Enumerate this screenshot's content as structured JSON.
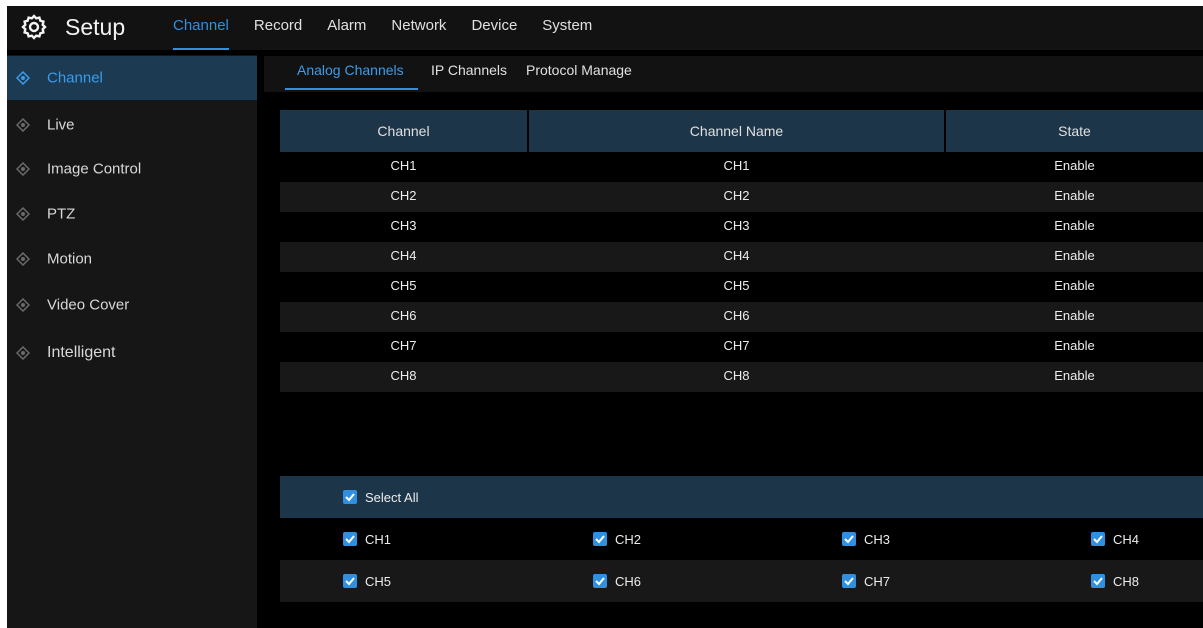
{
  "header": {
    "title": "Setup",
    "menu": [
      "Channel",
      "Record",
      "Alarm",
      "Network",
      "Device",
      "System"
    ]
  },
  "sidebar": {
    "items": [
      "Channel",
      "Live",
      "Image Control",
      "PTZ",
      "Motion",
      "Video Cover",
      "Intelligent"
    ]
  },
  "subtabs": [
    "Analog Channels",
    "IP Channels",
    "Protocol Manage"
  ],
  "table": {
    "headers": [
      "Channel",
      "Channel Name",
      "State"
    ],
    "rows": [
      {
        "channel": "CH1",
        "name": "CH1",
        "state": "Enable"
      },
      {
        "channel": "CH2",
        "name": "CH2",
        "state": "Enable"
      },
      {
        "channel": "CH3",
        "name": "CH3",
        "state": "Enable"
      },
      {
        "channel": "CH4",
        "name": "CH4",
        "state": "Enable"
      },
      {
        "channel": "CH5",
        "name": "CH5",
        "state": "Enable"
      },
      {
        "channel": "CH6",
        "name": "CH6",
        "state": "Enable"
      },
      {
        "channel": "CH7",
        "name": "CH7",
        "state": "Enable"
      },
      {
        "channel": "CH8",
        "name": "CH8",
        "state": "Enable"
      }
    ]
  },
  "select": {
    "all_label": "Select All",
    "all_checked": true,
    "channels": [
      {
        "label": "CH1",
        "checked": true
      },
      {
        "label": "CH2",
        "checked": true
      },
      {
        "label": "CH3",
        "checked": true
      },
      {
        "label": "CH4",
        "checked": true
      },
      {
        "label": "CH5",
        "checked": true
      },
      {
        "label": "CH6",
        "checked": true
      },
      {
        "label": "CH7",
        "checked": true
      },
      {
        "label": "CH8",
        "checked": true
      }
    ]
  },
  "colors": {
    "accent": "#2f8fe0",
    "header_row": "#1d3549",
    "sidebar_active": "#1c3a52",
    "background": "#000000"
  }
}
